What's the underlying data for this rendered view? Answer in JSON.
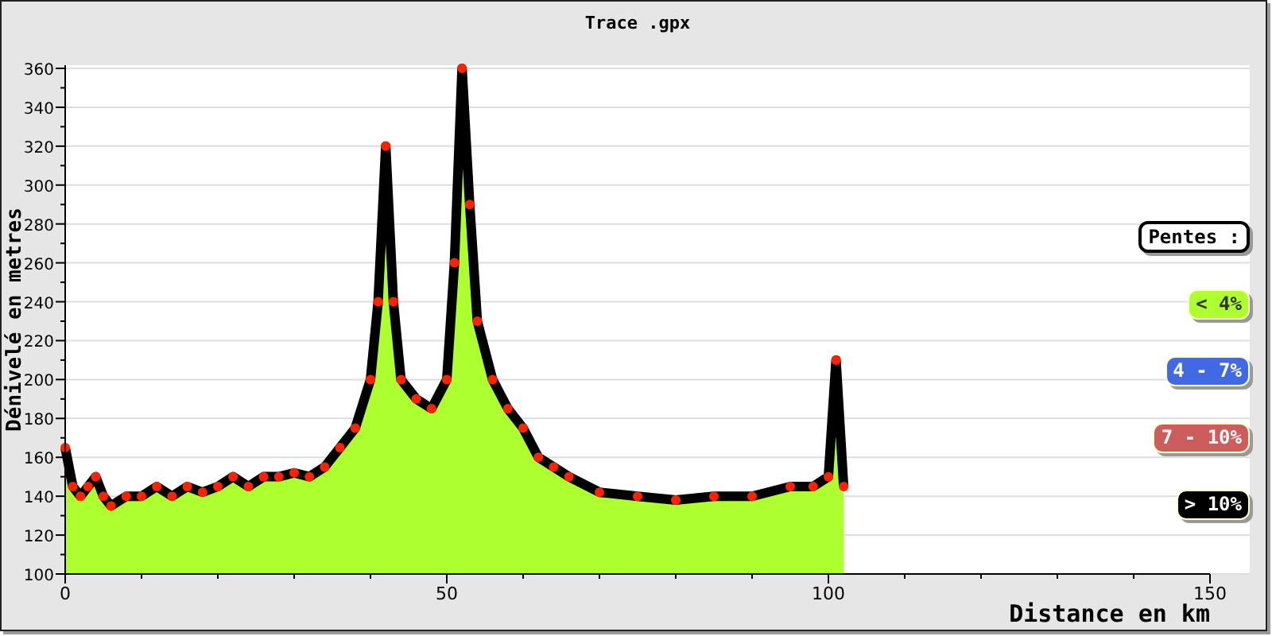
{
  "chart": {
    "chart_data": {
      "type": "area",
      "title": "Trace .gpx",
      "xlabel": "Distance en km",
      "ylabel": "Dénivelé en metres",
      "x": [
        0,
        1,
        2,
        3,
        4,
        5,
        6,
        8,
        10,
        12,
        14,
        16,
        18,
        20,
        22,
        24,
        26,
        28,
        30,
        32,
        34,
        36,
        38,
        40,
        41,
        42,
        43,
        44,
        46,
        48,
        50,
        51,
        52,
        53,
        54,
        56,
        58,
        60,
        62,
        64,
        66,
        70,
        75,
        80,
        85,
        90,
        95,
        98,
        100,
        101,
        102
      ],
      "series": [
        {
          "color": "#adff2f",
          "values": [
            165,
            145,
            140,
            145,
            150,
            140,
            135,
            140,
            140,
            145,
            140,
            145,
            142,
            145,
            150,
            145,
            150,
            150,
            152,
            150,
            155,
            165,
            175,
            200,
            240,
            320,
            240,
            200,
            190,
            185,
            200,
            260,
            360,
            290,
            230,
            200,
            185,
            175,
            160,
            155,
            150,
            142,
            140,
            138,
            140,
            140,
            145,
            145,
            150,
            210,
            145
          ]
        }
      ],
      "grid": true,
      "xlim": [
        0,
        150
      ],
      "ylim": [
        100,
        360
      ],
      "xticks": [
        0,
        50,
        100,
        150
      ],
      "yticks": [
        100,
        120,
        140,
        160,
        180,
        200,
        220,
        240,
        260,
        280,
        300,
        320,
        340,
        360
      ]
    }
  },
  "legend": {
    "title": "Pentes :",
    "items": [
      {
        "label": "< 4%",
        "color": "#adff2f"
      },
      {
        "label": "4 - 7%",
        "color": "#4169e1"
      },
      {
        "label": "7 - 10%",
        "color": "#cd5c5c"
      },
      {
        "label": "> 10%",
        "color": "#000000"
      }
    ]
  }
}
